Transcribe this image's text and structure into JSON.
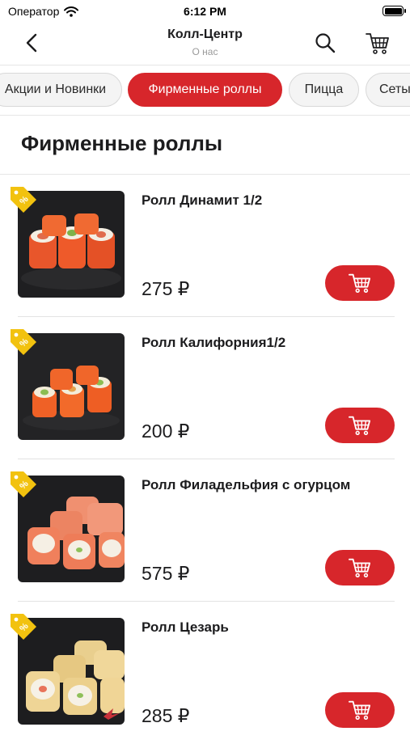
{
  "status_bar": {
    "carrier": "Оператор",
    "time": "6:12 PM"
  },
  "nav": {
    "title": "Колл-Центр",
    "subtitle": "О нас"
  },
  "categories": [
    {
      "label": "Акции и Новинки",
      "active": false
    },
    {
      "label": "Фирменные роллы",
      "active": true
    },
    {
      "label": "Пицца",
      "active": false
    },
    {
      "label": "Сеты",
      "active": false
    }
  ],
  "section_title": "Фирменные роллы",
  "products": [
    {
      "name": "Ролл Динамит 1/2",
      "price": "275 ₽"
    },
    {
      "name": "Ролл Калифорния1/2",
      "price": "200 ₽"
    },
    {
      "name": "Ролл Филадельфия с огурцом",
      "price": "575 ₽"
    },
    {
      "name": "Ролл Цезарь",
      "price": "285 ₽"
    }
  ],
  "colors": {
    "accent": "#d7262b",
    "badge": "#f2c20f",
    "thumb_bg": "#1f1f21"
  },
  "icons": [
    "back-chevron-icon",
    "search-icon",
    "cart-icon",
    "discount-tag-icon",
    "wifi-icon",
    "battery-icon"
  ]
}
